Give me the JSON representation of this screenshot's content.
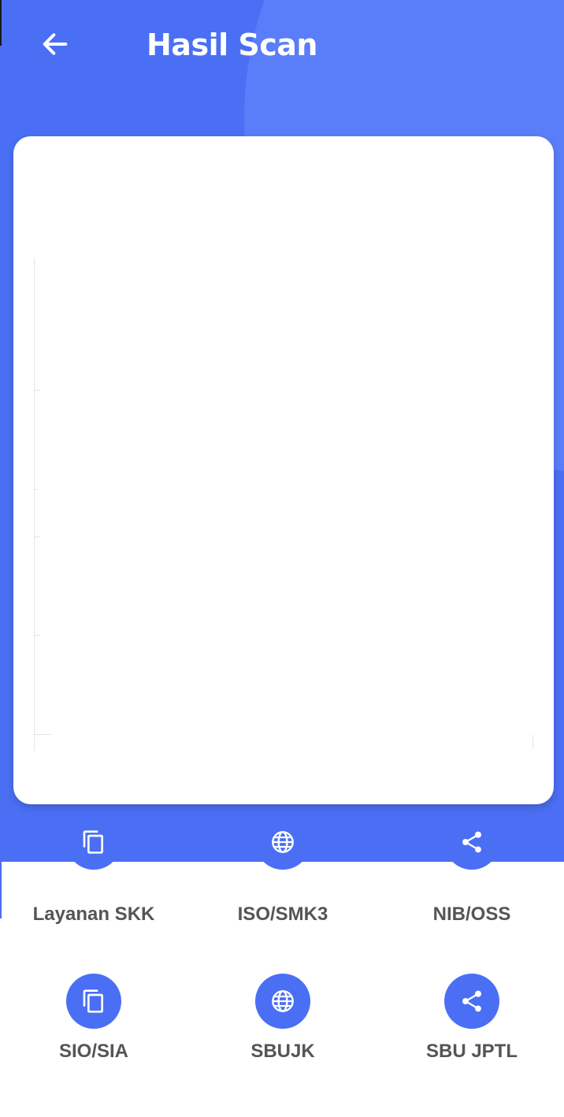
{
  "header": {
    "title": "Hasil Scan",
    "back_icon": "arrow-left-icon"
  },
  "colors": {
    "primary": "#4a6ff4",
    "primary_light": "#5a7ef9",
    "card": "#ffffff",
    "label": "#555555"
  },
  "scan_result": {
    "content": ""
  },
  "menu": {
    "items": [
      {
        "label": "Layanan SKK",
        "icon": "copy-icon"
      },
      {
        "label": "ISO/SMK3",
        "icon": "globe-icon"
      },
      {
        "label": "NIB/OSS",
        "icon": "share-icon"
      },
      {
        "label": "SIO/SIA",
        "icon": "copy-icon"
      },
      {
        "label": "SBUJK",
        "icon": "globe-icon"
      },
      {
        "label": "SBU JPTL",
        "icon": "share-icon"
      }
    ]
  }
}
